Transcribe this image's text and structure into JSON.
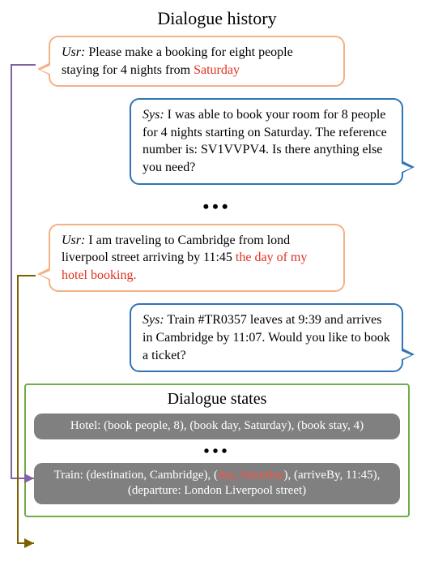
{
  "header": "Dialogue history",
  "bubbles": {
    "usr1": {
      "speaker": "Usr:",
      "pre": " Please make a booking for eight people staying for 4 nights from ",
      "hl": "Saturday",
      "post": ""
    },
    "sys1": {
      "speaker": "Sys:",
      "pre": " I was able to book your room for 8 people for 4 nights starting on Saturday. The reference number is: SV1VVPV4. Is there anything else you need?",
      "hl": "",
      "post": ""
    },
    "usr2": {
      "speaker": "Usr:",
      "pre": " I am traveling to Cambridge from lond liverpool street arriving by 11:45 ",
      "hl": "the day of my hotel booking.",
      "post": ""
    },
    "sys2": {
      "speaker": "Sys:",
      "pre": " Train #TR0357 leaves at 9:39 and arrives in Cambridge by 11:07. Would you like to book a ticket?",
      "hl": "",
      "post": ""
    }
  },
  "ellipsis": "•••",
  "states": {
    "title": "Dialogue states",
    "hotel": {
      "pre": "Hotel: (book people, 8), (book day, Saturday), (book stay, 4)",
      "hl": "",
      "post": ""
    },
    "train": {
      "pre": "Train: (destination, Cambridge), (",
      "hl": "day, Saturday",
      "post": "), (arriveBy, 11:45), (departure: London Liverpool street)"
    }
  }
}
